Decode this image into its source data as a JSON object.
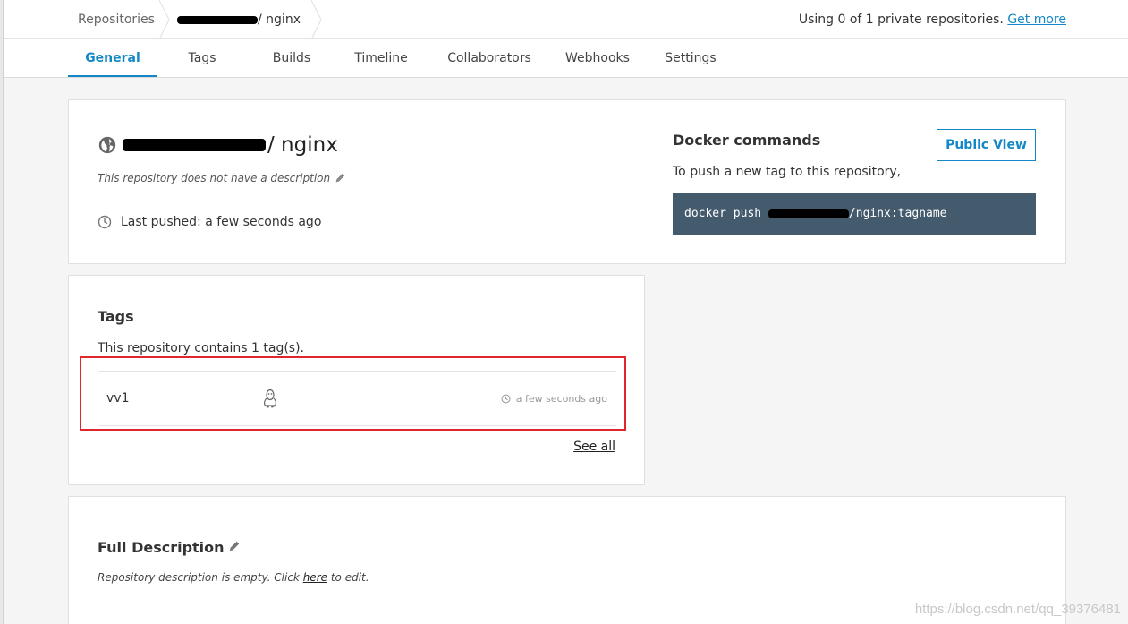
{
  "breadcrumb": {
    "root": "Repositories",
    "repo_suffix": "/ nginx"
  },
  "usage": {
    "text": "Using 0 of 1 private repositories.",
    "link": "Get more"
  },
  "tabs": [
    {
      "label": "General",
      "active": true
    },
    {
      "label": "Tags"
    },
    {
      "label": "Builds"
    },
    {
      "label": "Timeline"
    },
    {
      "label": "Collaborators"
    },
    {
      "label": "Webhooks"
    },
    {
      "label": "Settings"
    }
  ],
  "repo": {
    "name_suffix": "/ nginx",
    "no_description": "This repository does not have a description",
    "last_pushed": "Last pushed: a few seconds ago"
  },
  "docker": {
    "title": "Docker commands",
    "subtitle": "To push a new tag to this repository,",
    "public_view": "Public View",
    "cmd_prefix": "docker push ",
    "cmd_suffix": "/nginx:tagname"
  },
  "tags_section": {
    "title": "Tags",
    "count_text": "This repository contains 1 tag(s).",
    "rows": [
      {
        "name": "vv1",
        "time": "a few seconds ago"
      }
    ],
    "see_all": "See all"
  },
  "full_description": {
    "title": "Full Description",
    "prefix": "Repository description is empty. Click ",
    "link": "here",
    "suffix": " to edit."
  },
  "watermark": "https://blog.csdn.net/qq_39376481",
  "colors": {
    "accent": "#1488c6",
    "command_bg": "#445a6d",
    "highlight": "#e0262b"
  }
}
